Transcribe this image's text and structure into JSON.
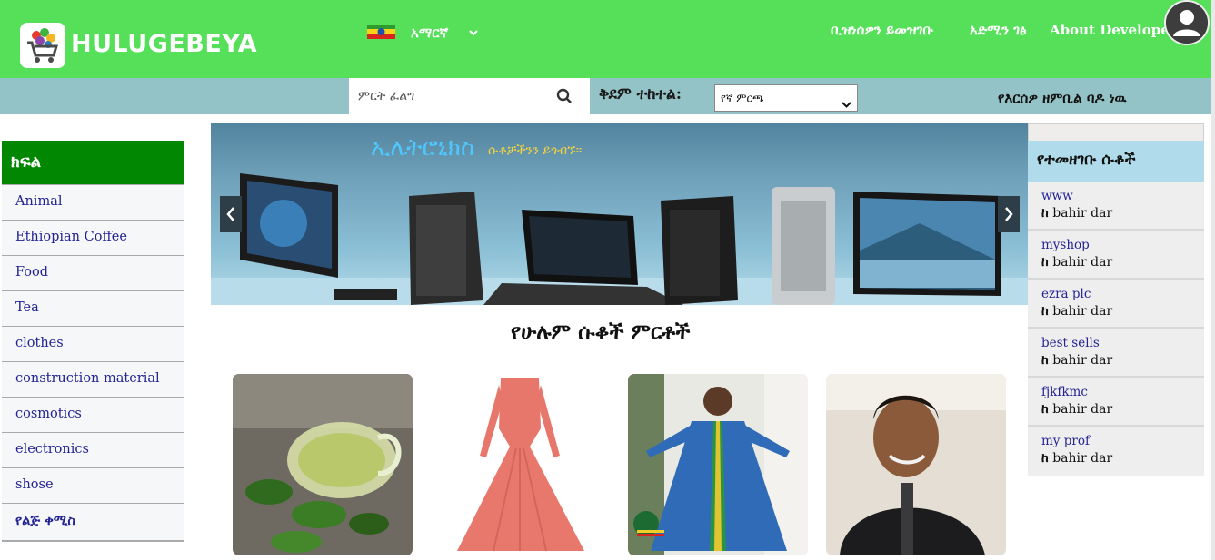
{
  "header": {
    "brand": "HULUGEBEYA",
    "language": "አማርኛ",
    "nav": [
      {
        "label": "ቢዝነሰዎን ይመዝገቡ"
      },
      {
        "label": "አድሚን ገፅ"
      },
      {
        "label": "About Developer"
      }
    ]
  },
  "toolbar": {
    "search_placeholder": "ምርት ፈልግ",
    "sort_label": "ቅደም ተከተል:",
    "sort_selected": "የኛ ምርጫ",
    "phone_message": "የእርሰዎ ዘምቢል ባዶ ነዉ"
  },
  "categories": {
    "title": "ክፍል",
    "items": [
      "Animal",
      "Ethiopian Coffee",
      "Food",
      "Tea",
      "clothes",
      "construction material",
      "cosmotics",
      "electronics",
      "shose",
      "የልጅ ቀሚስ"
    ]
  },
  "banner": {
    "title": "ኢሌትሮኒክስ",
    "subtitle": "ሱቆቻችንን ይጎብኙ።"
  },
  "products": {
    "title": "የሁሉም ሱቆች ምርቶች"
  },
  "shops": {
    "title": "የተመዘገቡ ሱቆች",
    "location_prefix": "ከ",
    "items": [
      {
        "name": "www",
        "location": "bahir dar"
      },
      {
        "name": "myshop",
        "location": "bahir dar"
      },
      {
        "name": "ezra plc",
        "location": "bahir dar"
      },
      {
        "name": "best sells",
        "location": "bahir dar"
      },
      {
        "name": "fjkfkmc",
        "location": "bahir dar"
      },
      {
        "name": "my prof",
        "location": "bahir dar"
      }
    ]
  },
  "colors": {
    "header_green": "#56e05a",
    "subbar_teal": "#93c3c6",
    "category_green": "#028702",
    "shops_blue": "#b0dbea"
  }
}
